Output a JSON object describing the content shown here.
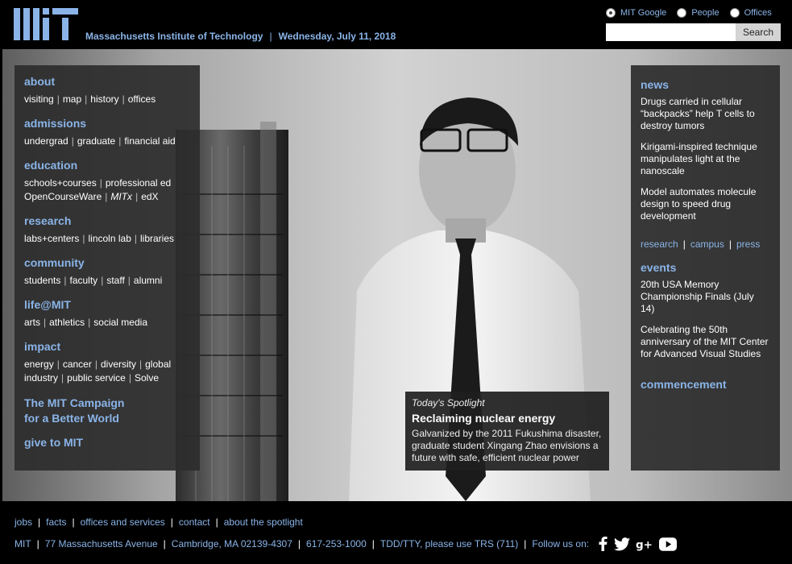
{
  "header": {
    "institute": "Massachusetts Institute of Technology",
    "date": "Wednesday, July 11, 2018",
    "search": {
      "options": [
        "MIT Google",
        "People",
        "Offices"
      ],
      "selected": "MIT Google",
      "placeholder": "",
      "button": "Search"
    }
  },
  "nav": {
    "about": {
      "label": "about",
      "links": [
        "visiting",
        "map",
        "history",
        "offices"
      ]
    },
    "admissions": {
      "label": "admissions",
      "links": [
        "undergrad",
        "graduate",
        "financial aid"
      ]
    },
    "education": {
      "label": "education",
      "links1": [
        "schools+courses",
        "professional ed"
      ],
      "links2": [
        "OpenCourseWare",
        "MITx",
        "edX"
      ]
    },
    "research": {
      "label": "research",
      "links": [
        "labs+centers",
        "lincoln lab",
        "libraries"
      ]
    },
    "community": {
      "label": "community",
      "links": [
        "students",
        "faculty",
        "staff",
        "alumni"
      ]
    },
    "life": {
      "label": "life@MIT",
      "links": [
        "arts",
        "athletics",
        "social media"
      ]
    },
    "impact": {
      "label": "impact",
      "links1": [
        "energy",
        "cancer",
        "diversity",
        "global"
      ],
      "links2": [
        "industry",
        "public service",
        "Solve"
      ]
    },
    "campaign": {
      "line1": "The MIT Campaign",
      "line2": "for a Better World"
    },
    "give": "give to MIT"
  },
  "news": {
    "heading": "news",
    "items": [
      "Drugs carried in cellular “backpacks” help T cells to destroy tumors",
      "Kirigami-inspired technique manipulates light at the nanoscale",
      "Model automates molecule design to speed drug development"
    ],
    "links": [
      "research",
      "campus",
      "press"
    ]
  },
  "events": {
    "heading": "events",
    "items": [
      "20th USA Memory Championship Finals (July 14)",
      "Celebrating the 50th anniversary of the MIT Center for Advanced Visual Studies"
    ]
  },
  "commencement": "commencement",
  "spotlight": {
    "label": "Today's Spotlight",
    "title": "Reclaiming nuclear energy",
    "description": "Galvanized by the 2011 Fukushima disaster, graduate student Xingang Zhao envisions a future with safe, efficient nuclear power"
  },
  "footer": {
    "links": [
      "jobs",
      "facts",
      "offices and services",
      "contact",
      "about the spotlight"
    ],
    "info": [
      "MIT",
      "77 Massachusetts Avenue",
      "Cambridge, MA 02139-4307",
      "617-253-1000",
      "TDD/TTY, please use TRS (711)"
    ],
    "follow": "Follow us on:",
    "social_icons": [
      "facebook-icon",
      "twitter-icon",
      "google-plus-icon",
      "youtube-icon"
    ]
  }
}
